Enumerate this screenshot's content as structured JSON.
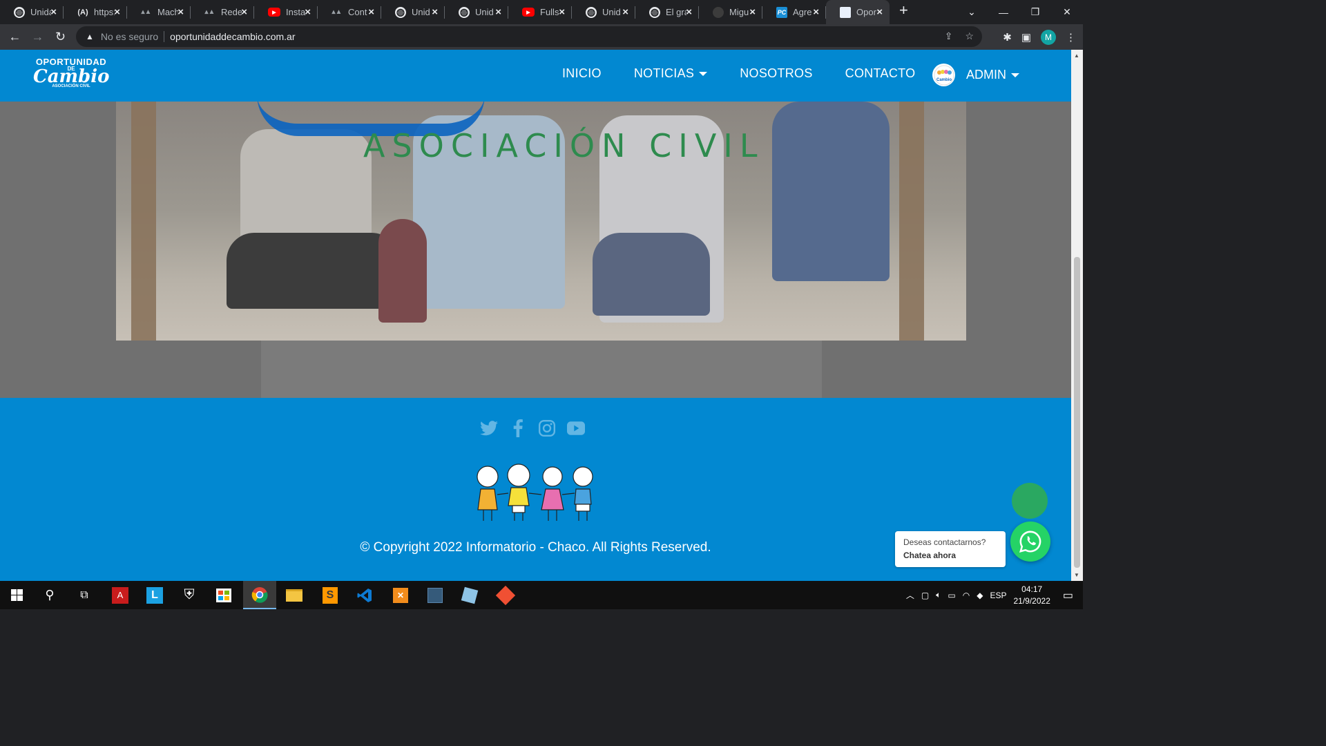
{
  "browser": {
    "tabs": [
      {
        "label": "Unidad",
        "icon": "globe"
      },
      {
        "label": "https:",
        "icon": "at"
      },
      {
        "label": "Mach",
        "icon": "ba"
      },
      {
        "label": "Redes",
        "icon": "ba"
      },
      {
        "label": "Insta",
        "icon": "yt"
      },
      {
        "label": "Cont",
        "icon": "ba"
      },
      {
        "label": "Unid",
        "icon": "globe"
      },
      {
        "label": "Unid",
        "icon": "globe"
      },
      {
        "label": "Fulls",
        "icon": "yt"
      },
      {
        "label": "Unid",
        "icon": "globe"
      },
      {
        "label": "El gra",
        "icon": "globe"
      },
      {
        "label": "Migu",
        "icon": "gh"
      },
      {
        "label": "Agre",
        "icon": "pc"
      },
      {
        "label": "Opor",
        "icon": "op",
        "active": true
      }
    ],
    "security_label": "No es seguro",
    "url": "oportunidaddecambio.com.ar",
    "profile_initial": "M"
  },
  "site": {
    "logo": {
      "line1": "OPORTUNIDAD",
      "line2": "DE",
      "line3": "Cambio",
      "line4": "ASOCIACIÓN CIVIL"
    },
    "nav": {
      "inicio": "INICIO",
      "noticias": "NOTICIAS",
      "nosotros": "NOSOTROS",
      "contacto": "CONTACTO",
      "admin": "ADMIN"
    },
    "hero_text": "ASOCIACIÓN CIVIL",
    "copyright": "© Copyright 2022 Informatorio - Chaco. All Rights Reserved.",
    "chat": {
      "line1": "Deseas contactarnos?",
      "line2": "Chatea ahora"
    }
  },
  "taskbar": {
    "language": "ESP",
    "time": "04:17",
    "date": "21/9/2022"
  },
  "colors": {
    "brand_blue": "#0288d1",
    "hero_green": "#2e8b4e",
    "whatsapp": "#25d366"
  }
}
